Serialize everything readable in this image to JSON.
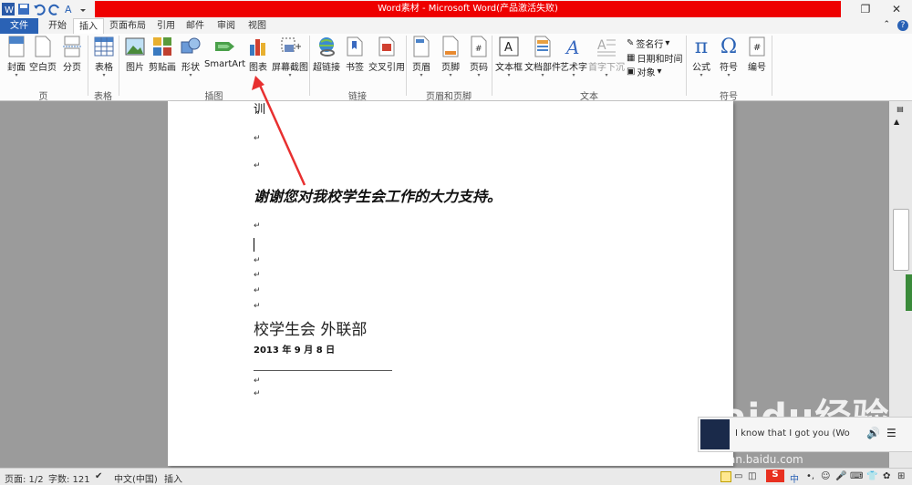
{
  "window": {
    "title": "Word素材 - Microsoft Word(产品激活失败)",
    "accent_color": "#ee0000",
    "file_tab_color": "#2a62b5"
  },
  "tabs": [
    "文件",
    "开始",
    "插入",
    "页面布局",
    "引用",
    "邮件",
    "审阅",
    "视图"
  ],
  "active_tab": "插入",
  "ribbon": {
    "groups": {
      "pages": {
        "label": "页",
        "buttons": [
          "封面",
          "空白页",
          "分页"
        ]
      },
      "tables": {
        "label": "表格",
        "buttons": [
          "表格"
        ]
      },
      "illustrations": {
        "label": "插图",
        "buttons": [
          "图片",
          "剪贴画",
          "形状",
          "SmartArt",
          "图表",
          "屏幕截图"
        ]
      },
      "links": {
        "label": "链接",
        "buttons": [
          "超链接",
          "书签",
          "交叉引用"
        ]
      },
      "header_footer": {
        "label": "页眉和页脚",
        "buttons": [
          "页眉",
          "页脚",
          "页码"
        ]
      },
      "text": {
        "label": "文本",
        "buttons": [
          "文本框",
          "文档部件",
          "艺术字",
          "首字下沉"
        ],
        "small": [
          "签名行",
          "日期和时间",
          "对象"
        ]
      },
      "symbols": {
        "label": "符号",
        "buttons": [
          "公式",
          "符号",
          "编号"
        ]
      }
    }
  },
  "document": {
    "top_fragment": "训",
    "thanks_line": "谢谢您对我校学生会工作的大力支持。",
    "org_line": "校学生会  外联部",
    "date_line": "2013 年 9 月 8 日"
  },
  "statusbar": {
    "page": "页面: 1/2",
    "words": "字数: 121",
    "language": "中文(中国)",
    "mode": "插入"
  },
  "notification": {
    "text": "I know that I got you (Wo"
  },
  "watermark": {
    "brand": "Baidu经验",
    "url": "jingyan.baidu.com"
  }
}
